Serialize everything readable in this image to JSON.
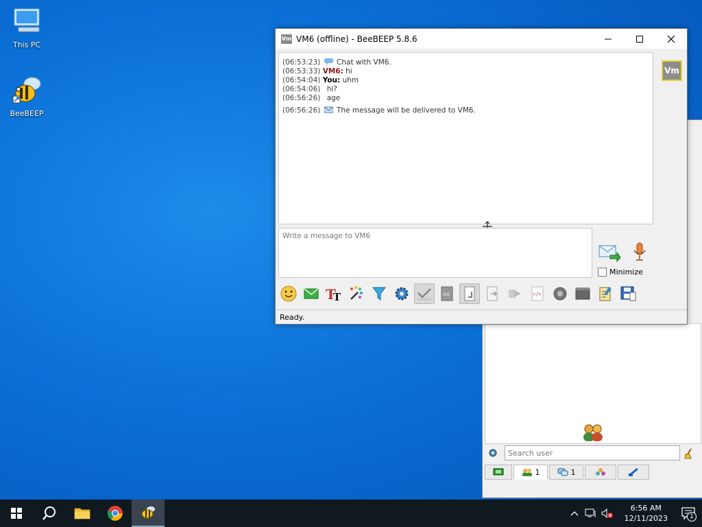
{
  "desktop": {
    "icons": [
      {
        "label": "This PC"
      },
      {
        "label": "BeeBEEP"
      }
    ]
  },
  "chat_window": {
    "title": "VM6 (offline) - BeeBEEP 5.8.6",
    "app_icon_text": "Vm",
    "avatar_text": "Vm",
    "messages": [
      {
        "time": "(06:53:23)",
        "sender": "",
        "text": "Chat with VM6."
      },
      {
        "time": "(06:53:33)",
        "sender": "VM6:",
        "text": "hi"
      },
      {
        "time": "(06:54:04)",
        "sender": "You:",
        "text": "uhm"
      },
      {
        "time": "(06:54:06)",
        "sender": "",
        "text": "hi?"
      },
      {
        "time": "(06:56:26)",
        "sender": "",
        "text": "age"
      },
      {
        "time": "(06:56:26)",
        "sender": "",
        "text": "The message will be delivered to VM6."
      }
    ],
    "compose_placeholder": "Write a message to VM6",
    "minimize_label": "Minimize",
    "status": "Ready."
  },
  "main_window": {
    "search_placeholder": "Search user",
    "tabs": [
      {
        "icon": "computer-icon",
        "count": ""
      },
      {
        "icon": "users-icon",
        "count": "1"
      },
      {
        "icon": "chats-icon",
        "count": "1"
      },
      {
        "icon": "groups-icon",
        "count": ""
      },
      {
        "icon": "files-icon",
        "count": ""
      }
    ]
  },
  "taskbar": {
    "time": "6:56 AM",
    "date": "12/11/2023",
    "notification_count": "1"
  },
  "colors": {
    "desktop_bg": "#0a6fd6",
    "sender_vm6": "#8b1a1a",
    "avatar_border": "#e8d330",
    "taskbar_bg": "#101820"
  }
}
